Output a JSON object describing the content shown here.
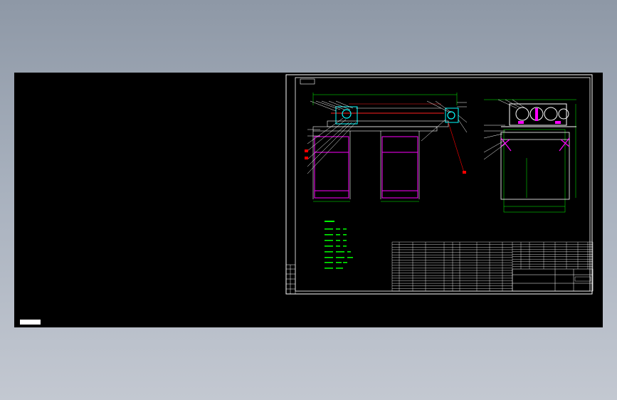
{
  "colors": {
    "border": "#ffffff",
    "dimension": "#00ff00",
    "structure": "#ffffff",
    "frame": "#ff00ff",
    "centerline": "#ff2020",
    "component": "#00ffff",
    "leader": "#ff0000",
    "notes": "#00ff00"
  },
  "model_tab_label": "",
  "drawing": {
    "label_box_text": "",
    "overall_length_text": "",
    "leg_width_left_text": "",
    "leg_width_right_text": "",
    "side_height_text": "",
    "side_width_text": "",
    "notes": [
      "",
      "",
      "",
      "",
      "",
      "",
      "",
      "",
      ""
    ],
    "title_block_name": "",
    "title_block_code": ""
  }
}
